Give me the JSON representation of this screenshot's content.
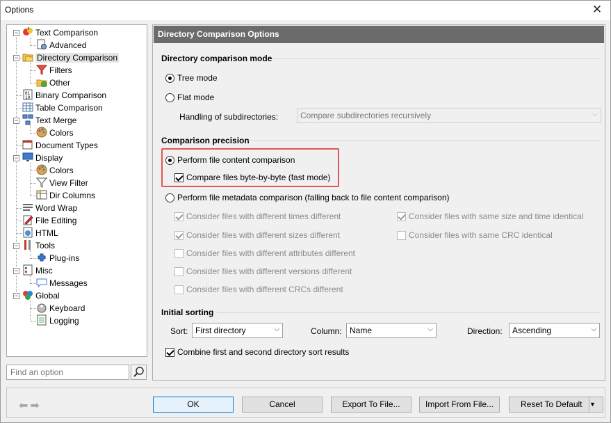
{
  "window": {
    "title": "Options"
  },
  "tree": [
    {
      "label": "Text Comparison",
      "level": 0,
      "icon": "text-comparison-icon"
    },
    {
      "label": "Advanced",
      "level": 1,
      "icon": "advanced-icon"
    },
    {
      "label": "Directory Comparison",
      "level": 0,
      "icon": "folder-icon",
      "selected": true
    },
    {
      "label": "Filters",
      "level": 1,
      "icon": "filter-icon"
    },
    {
      "label": "Other",
      "level": 1,
      "icon": "other-icon"
    },
    {
      "label": "Binary Comparison",
      "level": 0,
      "icon": "binary-icon"
    },
    {
      "label": "Table Comparison",
      "level": 0,
      "icon": "table-icon"
    },
    {
      "label": "Text Merge",
      "level": 0,
      "icon": "merge-icon"
    },
    {
      "label": "Colors",
      "level": 1,
      "icon": "palette-icon"
    },
    {
      "label": "Document Types",
      "level": 0,
      "icon": "document-types-icon"
    },
    {
      "label": "Display",
      "level": 0,
      "icon": "monitor-icon"
    },
    {
      "label": "Colors",
      "level": 1,
      "icon": "palette-icon"
    },
    {
      "label": "View Filter",
      "level": 1,
      "icon": "filter-icon"
    },
    {
      "label": "Dir Columns",
      "level": 1,
      "icon": "columns-icon"
    },
    {
      "label": "Word Wrap",
      "level": 0,
      "icon": "word-wrap-icon"
    },
    {
      "label": "File Editing",
      "level": 0,
      "icon": "pencil-icon"
    },
    {
      "label": "HTML",
      "level": 0,
      "icon": "html-icon"
    },
    {
      "label": "Tools",
      "level": 0,
      "icon": "tools-icon"
    },
    {
      "label": "Plug-ins",
      "level": 1,
      "icon": "plugin-icon"
    },
    {
      "label": "Misc",
      "level": 0,
      "icon": "misc-icon"
    },
    {
      "label": "Messages",
      "level": 1,
      "icon": "message-icon"
    },
    {
      "label": "Global",
      "level": 0,
      "icon": "global-icon"
    },
    {
      "label": "Keyboard",
      "level": 1,
      "icon": "keyboard-icon"
    },
    {
      "label": "Logging",
      "level": 1,
      "icon": "logging-icon"
    }
  ],
  "search": {
    "placeholder": "Find an option"
  },
  "panel": {
    "header": "Directory Comparison Options",
    "mode": {
      "title": "Directory comparison mode",
      "tree_mode": "Tree mode",
      "flat_mode": "Flat mode",
      "subdir_label": "Handling of subdirectories:",
      "subdir_value": "Compare subdirectories recursively"
    },
    "precision": {
      "title": "Comparison precision",
      "content": "Perform file content comparison",
      "byte": "Compare files byte-by-byte (fast mode)",
      "metadata": "Perform file metadata comparison (falling back to file content comparison)",
      "times_diff": "Consider files with different times different",
      "sizes_diff": "Consider files with different sizes different",
      "attr_diff": "Consider files with different attributes different",
      "versions_diff": "Consider files with different versions different",
      "crc_diff": "Consider files with different CRCs different",
      "same_size_time": "Consider files with same size and time identical",
      "same_crc": "Consider files with same CRC identical"
    },
    "sorting": {
      "title": "Initial sorting",
      "sort_label": "Sort:",
      "sort_value": "First directory",
      "column_label": "Column:",
      "column_value": "Name",
      "direction_label": "Direction:",
      "direction_value": "Ascending",
      "combine": "Combine first and second directory sort results"
    }
  },
  "buttons": {
    "ok": "OK",
    "cancel": "Cancel",
    "export": "Export To File...",
    "import": "Import From File...",
    "reset": "Reset To Default"
  },
  "colors": {
    "highlight": "#e05757",
    "header_bg": "#6b6b6b",
    "accent": "#0078d7"
  }
}
